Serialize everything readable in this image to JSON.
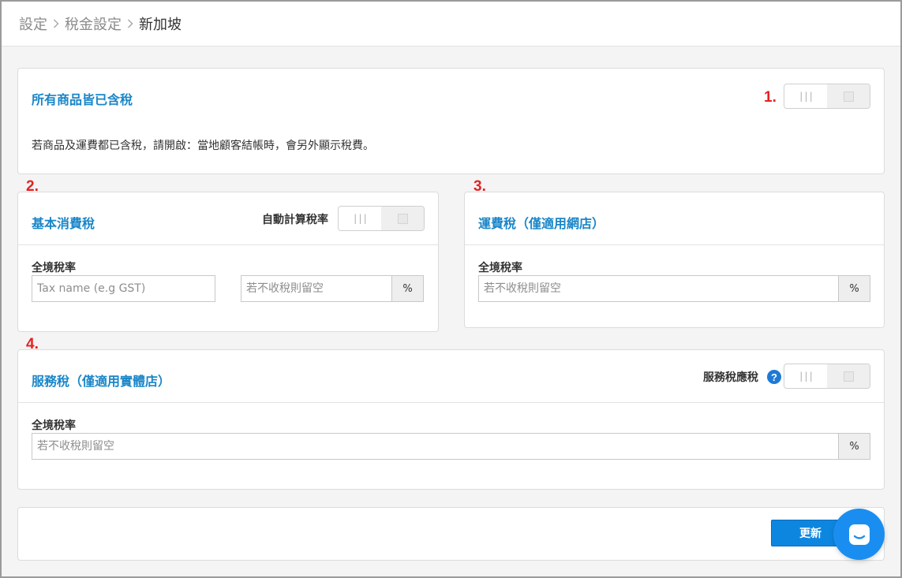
{
  "breadcrumb": {
    "items": [
      "設定",
      "稅金設定"
    ],
    "current": "新加坡"
  },
  "tax_included": {
    "marker": "1.",
    "title": "所有商品皆已含稅",
    "description": "若商品及運費都已含稅，請開啟：當地顧客結帳時，會另外顯示稅費。",
    "toggle_state": "off"
  },
  "basic_tax": {
    "marker": "2.",
    "title": "基本消費稅",
    "auto_label": "自動計算稅率",
    "auto_toggle_state": "off",
    "rate_label": "全境稅率",
    "name_placeholder": "Tax name (e.g GST)",
    "rate_placeholder": "若不收稅則留空",
    "unit": "%"
  },
  "shipping_tax": {
    "marker": "3.",
    "title": "運費稅（僅適用網店）",
    "rate_label": "全境稅率",
    "rate_placeholder": "若不收稅則留空",
    "unit": "%"
  },
  "service_tax": {
    "marker": "4.",
    "title": "服務稅（僅適用實體店）",
    "taxable_label": "服務稅應稅",
    "help_icon": "?",
    "taxable_toggle_state": "off",
    "rate_label": "全境稅率",
    "rate_placeholder": "若不收稅則留空",
    "unit": "%"
  },
  "footer": {
    "update_label": "更新"
  },
  "colors": {
    "accent": "#1a86c8",
    "marker": "#e32222",
    "primary_button": "#0d86e0",
    "chat_launcher": "#1a8ef0"
  }
}
